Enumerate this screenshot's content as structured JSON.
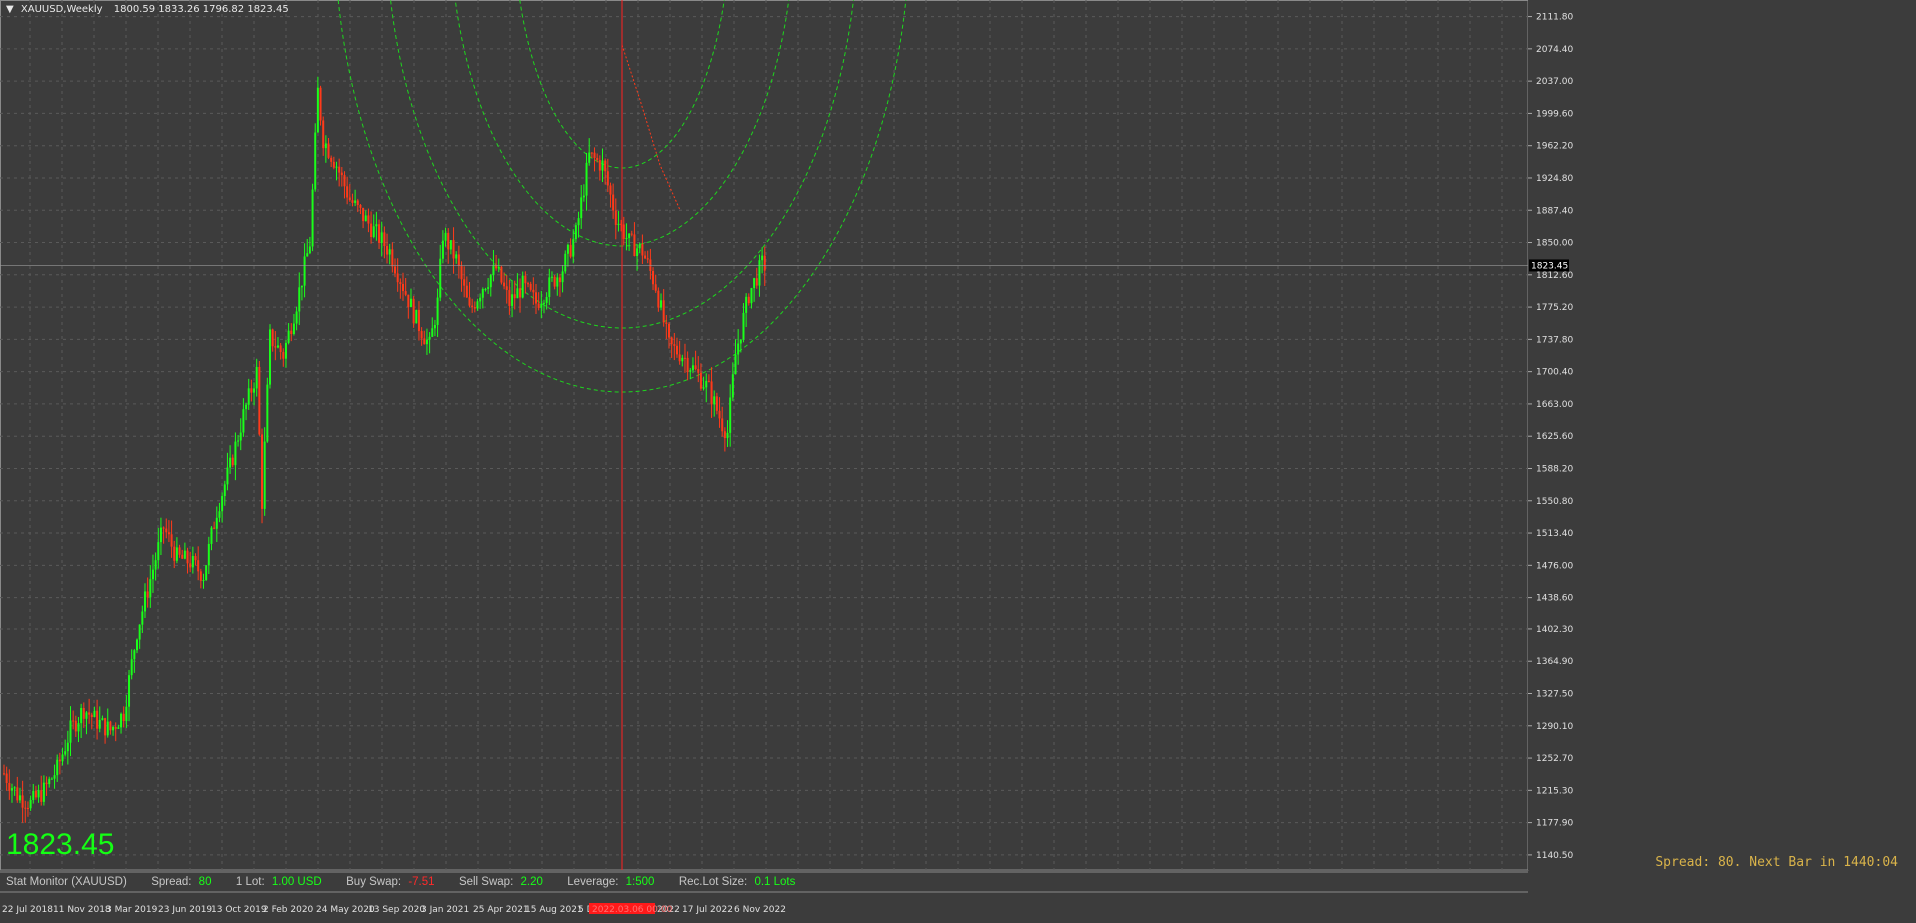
{
  "header": {
    "symbol": "XAUUSD,Weekly",
    "ohlc": "1800.59 1833.26 1796.82 1823.45",
    "caret": "▼"
  },
  "overlay": {
    "current_price": "1823.45",
    "spread_next_bar": "Spread: 80. Next Bar in 1440:04"
  },
  "stat_monitor": {
    "title": "Stat Monitor (XAUUSD)",
    "spread_label": "Spread:",
    "spread_value": "80",
    "lot_label": "1 Lot:",
    "lot_value": "1.00 USD",
    "buy_swap_label": "Buy Swap:",
    "buy_swap_value": "-7.51",
    "sell_swap_label": "Sell Swap:",
    "sell_swap_value": "2.20",
    "leverage_label": "Leverage:",
    "leverage_value": "1:500",
    "rec_lot_label": "Rec.Lot Size:",
    "rec_lot_value": "0.1 Lots"
  },
  "colors": {
    "background": "#3c3c3c",
    "grid": "#5a5a5a",
    "bull": "#1aff1a",
    "bear": "#ff3a1a",
    "arcs": "#1ed61e",
    "vline": "#ff2020",
    "price_line": "#9a9a9a"
  },
  "chart_data": {
    "type": "candlestick",
    "title": "",
    "y_ticks": [
      "2111.80",
      "2074.40",
      "2037.00",
      "1999.60",
      "1962.20",
      "1924.80",
      "1887.40",
      "1850.00",
      "1812.60",
      "1775.20",
      "1737.80",
      "1700.40",
      "1663.00",
      "1625.60",
      "1588.20",
      "1550.80",
      "1513.40",
      "1476.00",
      "1438.60",
      "1402.30",
      "1364.90",
      "1327.50",
      "1290.10",
      "1252.70",
      "1215.30",
      "1177.90",
      "1140.50"
    ],
    "ylim": [
      1123.0,
      2131.0
    ],
    "current_price": 1823.45,
    "current_price_label": "1823.45",
    "x_labels": [
      "22 Jul 2018",
      "11 Nov 2018",
      "3 Mar 2019",
      "23 Jun 2019",
      "13 Oct 2019",
      "2 Feb 2020",
      "24 May 2020",
      "13 Sep 2020",
      "3 Jan 2021",
      "25 Apr 2021",
      "15 Aug 2021",
      "5 D",
      "2022",
      "17 Jul 2022",
      "6 Nov 2022"
    ],
    "highlighted_date": "2022.03.06 00:00",
    "close_path": [
      [
        0,
        1235
      ],
      [
        5,
        1210
      ],
      [
        10,
        1200
      ],
      [
        15,
        1215
      ],
      [
        20,
        1240
      ],
      [
        25,
        1285
      ],
      [
        30,
        1310
      ],
      [
        35,
        1295
      ],
      [
        40,
        1285
      ],
      [
        45,
        1305
      ],
      [
        50,
        1400
      ],
      [
        55,
        1460
      ],
      [
        60,
        1520
      ],
      [
        65,
        1485
      ],
      [
        70,
        1480
      ],
      [
        75,
        1465
      ],
      [
        80,
        1540
      ],
      [
        85,
        1590
      ],
      [
        90,
        1650
      ],
      [
        95,
        1700
      ],
      [
        97,
        1550
      ],
      [
        100,
        1740
      ],
      [
        105,
        1720
      ],
      [
        110,
        1780
      ],
      [
        115,
        1850
      ],
      [
        118,
        2025
      ],
      [
        120,
        1970
      ],
      [
        125,
        1940
      ],
      [
        130,
        1900
      ],
      [
        135,
        1880
      ],
      [
        140,
        1860
      ],
      [
        145,
        1840
      ],
      [
        150,
        1800
      ],
      [
        155,
        1760
      ],
      [
        160,
        1730
      ],
      [
        163,
        1780
      ],
      [
        165,
        1860
      ],
      [
        170,
        1830
      ],
      [
        175,
        1770
      ],
      [
        180,
        1800
      ],
      [
        185,
        1820
      ],
      [
        190,
        1780
      ],
      [
        195,
        1800
      ],
      [
        200,
        1780
      ],
      [
        205,
        1800
      ],
      [
        210,
        1820
      ],
      [
        215,
        1860
      ],
      [
        220,
        1950
      ],
      [
        225,
        1940
      ],
      [
        230,
        1880
      ],
      [
        235,
        1850
      ],
      [
        240,
        1840
      ],
      [
        245,
        1800
      ],
      [
        250,
        1730
      ],
      [
        255,
        1720
      ],
      [
        260,
        1700
      ],
      [
        265,
        1680
      ],
      [
        270,
        1640
      ],
      [
        272,
        1630
      ],
      [
        275,
        1720
      ],
      [
        280,
        1790
      ],
      [
        285,
        1825
      ],
      [
        286,
        1823.45
      ]
    ],
    "vline_bar": 228,
    "arc_center_bar": 228,
    "arc_center_price": 2160,
    "arc_radii_bars": [
      40,
      65,
      90,
      105
    ],
    "total_bars": 560
  }
}
